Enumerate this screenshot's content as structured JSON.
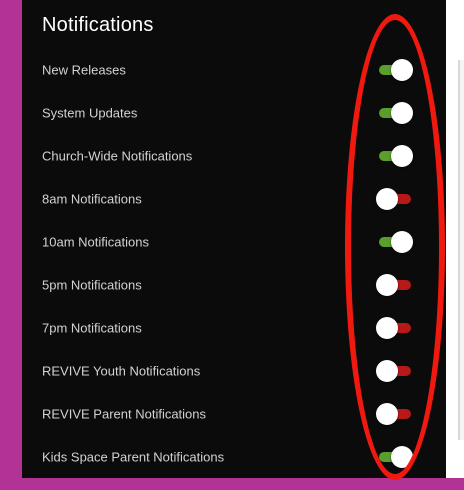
{
  "header": {
    "title": "Notifications"
  },
  "colors": {
    "accent": "#b33296",
    "panel_background": "#0b0b0b",
    "toggle_on": "#5a9e2c",
    "toggle_off": "#b81818",
    "annotation": "#f0190f"
  },
  "notifications": [
    {
      "label": "New Releases",
      "enabled": true
    },
    {
      "label": "System Updates",
      "enabled": true
    },
    {
      "label": "Church-Wide Notifications",
      "enabled": true
    },
    {
      "label": "8am Notifications",
      "enabled": false
    },
    {
      "label": "10am Notifications",
      "enabled": true
    },
    {
      "label": "5pm Notifications",
      "enabled": false
    },
    {
      "label": "7pm Notifications",
      "enabled": false
    },
    {
      "label": "REVIVE Youth Notifications",
      "enabled": false
    },
    {
      "label": "REVIVE Parent Notifications",
      "enabled": false
    },
    {
      "label": "Kids Space Parent Notifications",
      "enabled": true
    }
  ]
}
